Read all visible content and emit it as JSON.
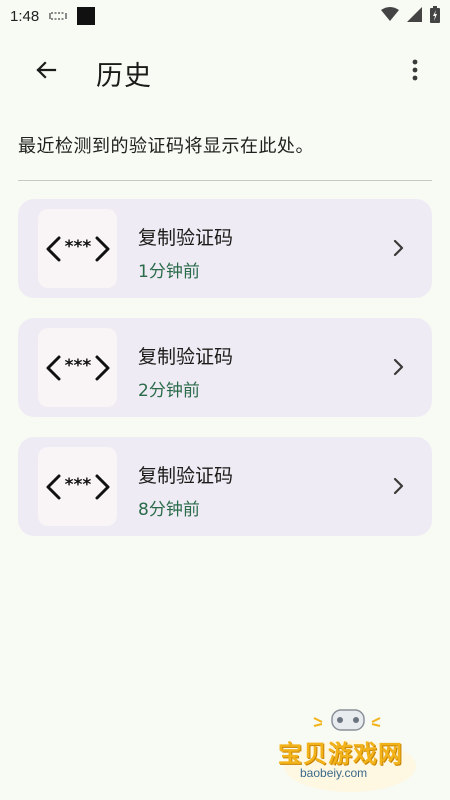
{
  "status_bar": {
    "time": "1:48",
    "icons": [
      "cast-icon",
      "square-notification-icon",
      "wifi-icon",
      "signal-icon",
      "battery-icon"
    ]
  },
  "header": {
    "title": "历史",
    "back_icon": "arrow-back-icon",
    "menu_icon": "more-vertical-icon"
  },
  "description": "最近检测到的验证码将显示在此处。",
  "history": [
    {
      "title": "复制验证码",
      "time": "1分钟前",
      "icon": "code-bracket-icon"
    },
    {
      "title": "复制验证码",
      "time": "2分钟前",
      "icon": "code-bracket-icon"
    },
    {
      "title": "复制验证码",
      "time": "8分钟前",
      "icon": "code-bracket-icon"
    }
  ],
  "watermark": {
    "text": "宝贝游戏网",
    "url": "baobeiy.com"
  },
  "colors": {
    "background": "#f7fbf4",
    "card": "#efebf4",
    "time_text": "#2a6b4a",
    "watermark": "#f2b21a"
  }
}
